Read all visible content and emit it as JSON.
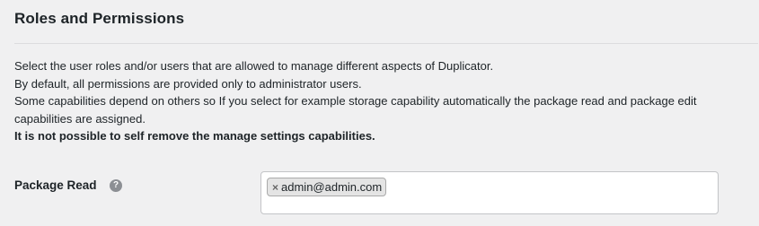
{
  "section": {
    "title": "Roles and Permissions"
  },
  "description": {
    "line1": "Select the user roles and/or users that are allowed to manage different aspects of Duplicator.",
    "line2": "By default, all permissions are provided only to administrator users.",
    "line3": "Some capabilities depend on others so If you select for example storage capability automatically the package read and package edit capabilities are assigned.",
    "line4": "It is not possible to self remove the manage settings capabilities."
  },
  "fields": [
    {
      "label": "Package Read",
      "help_icon": "question-circle-icon",
      "selected": [
        {
          "label": "admin@admin.com",
          "remove_symbol": "×"
        }
      ]
    }
  ],
  "colors": {
    "background": "#f0f0f1",
    "text": "#1d2327",
    "tag_bg": "#e4e4e4",
    "input_border": "#c3c4c7"
  }
}
